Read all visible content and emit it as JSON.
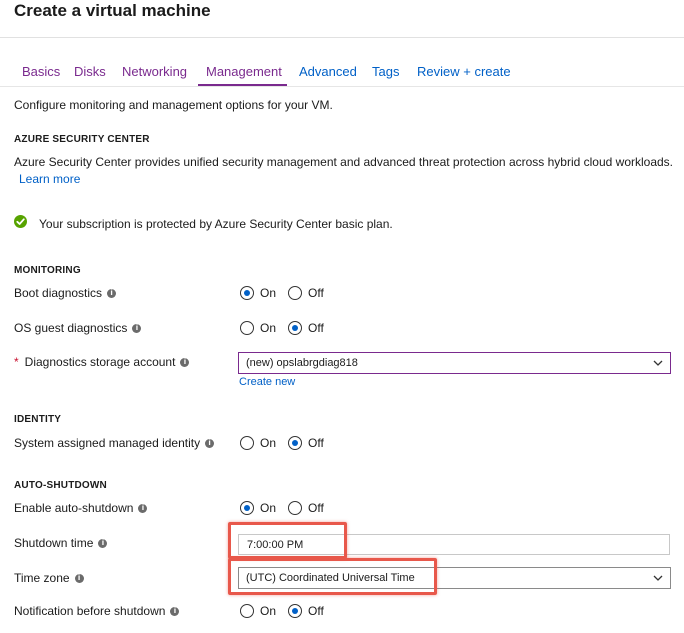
{
  "page": {
    "title": "Create a virtual machine"
  },
  "tabs": [
    {
      "label": "Basics",
      "active": false
    },
    {
      "label": "Disks",
      "active": false
    },
    {
      "label": "Networking",
      "active": false
    },
    {
      "label": "Management",
      "active": true
    },
    {
      "label": "Advanced",
      "active": false
    },
    {
      "label": "Tags",
      "active": false
    },
    {
      "label": "Review + create",
      "active": false
    }
  ],
  "intro": "Configure monitoring and management options for your VM.",
  "security_center": {
    "heading": "AZURE SECURITY CENTER",
    "description": "Azure Security Center provides unified security management and advanced threat protection across hybrid cloud workloads.",
    "learn_more": "Learn more",
    "status_text": "Your subscription is protected by Azure Security Center basic plan.",
    "status_icon": "check-circle-icon"
  },
  "monitoring": {
    "heading": "MONITORING",
    "boot_diagnostics": {
      "label": "Boot diagnostics",
      "on": "On",
      "off": "Off",
      "value": "On"
    },
    "os_guest_diagnostics": {
      "label": "OS guest diagnostics",
      "on": "On",
      "off": "Off",
      "value": "Off"
    },
    "storage_account": {
      "required_mark": "*",
      "label": "Diagnostics storage account",
      "value": "(new) opslabrgdiag818",
      "create_new": "Create new"
    }
  },
  "identity": {
    "heading": "IDENTITY",
    "managed_identity": {
      "label": "System assigned managed identity",
      "on": "On",
      "off": "Off",
      "value": "Off"
    }
  },
  "auto_shutdown": {
    "heading": "AUTO-SHUTDOWN",
    "enable": {
      "label": "Enable auto-shutdown",
      "on": "On",
      "off": "Off",
      "value": "On"
    },
    "shutdown_time": {
      "label": "Shutdown time",
      "value": "7:00:00 PM"
    },
    "time_zone": {
      "label": "Time zone",
      "value": "(UTC) Coordinated Universal Time"
    },
    "notification": {
      "label": "Notification before shutdown",
      "on": "On",
      "off": "Off",
      "value": "Off"
    }
  },
  "info_icon_glyph": "i",
  "colors": {
    "accent_purple": "#7a2a8e",
    "link_blue": "#0060c7",
    "highlight_red": "#e8584b",
    "success_green": "#57a300",
    "required_red": "#c8102e"
  }
}
